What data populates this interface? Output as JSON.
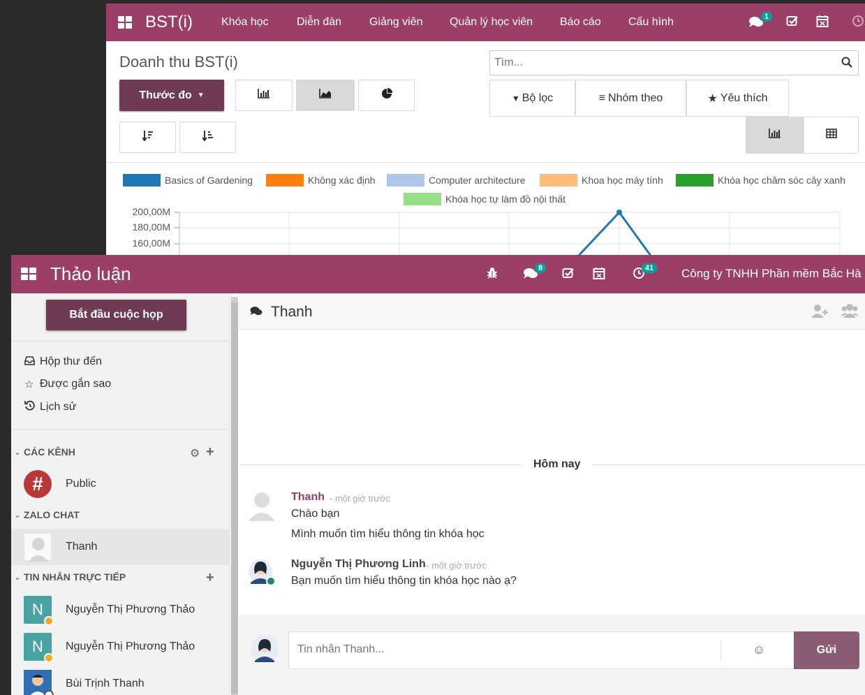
{
  "back_window": {
    "navbar": {
      "brand": "BST(i)",
      "menu": [
        "Khóa học",
        "Diễn đàn",
        "Giảng viên",
        "Quản lý học viên",
        "Báo cáo",
        "Cấu hình"
      ],
      "messages_badge": "1"
    },
    "title": "Doanh thu BST(i)",
    "measures_button": "Thước đo",
    "search_placeholder": "Tìm...",
    "filters": {
      "filter": "Bộ lọc",
      "group_by": "Nhóm theo",
      "favorites": "Yêu thích"
    },
    "icons": {
      "bar_chart": "bar-chart-icon",
      "area_chart": "area-chart-icon",
      "pie_chart": "pie-chart-icon",
      "sort_desc": "sort-desc-icon",
      "sort_asc": "sort-asc-icon",
      "graph_view": "graph-view-icon",
      "pivot_view": "pivot-view-icon"
    }
  },
  "chart_data": {
    "type": "line",
    "series": [
      {
        "name": "Basics of Gardening",
        "color": "#1f77b4"
      },
      {
        "name": "Không xác định",
        "color": "#ff7f0e"
      },
      {
        "name": "Computer architecture",
        "color": "#aec7e8"
      },
      {
        "name": "Khoa học máy tính",
        "color": "#ffbb78"
      },
      {
        "name": "Khóa học chăm sóc cây xanh",
        "color": "#2ca02c"
      },
      {
        "name": "Khóa học tự làm đồ nội thất",
        "color": "#98df8a"
      }
    ],
    "y_ticks": [
      "200,00M",
      "180,00M",
      "160,00M"
    ],
    "peak_value": 200000000
  },
  "front_window": {
    "navbar": {
      "brand": "Thảo luận",
      "messages_badge": "8",
      "activity_badge": "41",
      "company": "Công ty TNHH Phần mềm Bắc Hà"
    },
    "sidebar": {
      "start_meeting": "Bắt đầu cuộc họp",
      "mailboxes": [
        {
          "label": "Hộp thư đến",
          "icon": "inbox-icon"
        },
        {
          "label": "Được gắn sao",
          "icon": "star-icon"
        },
        {
          "label": "Lịch sử",
          "icon": "history-icon"
        }
      ],
      "channels_header": "CÁC KÊNH",
      "channels": [
        {
          "label": "Public"
        }
      ],
      "zalo_header": "ZALO CHAT",
      "zalo": [
        {
          "label": "Thanh"
        }
      ],
      "direct_header": "TIN NHẮN TRỰC TIẾP",
      "direct": [
        {
          "label": "Nguyễn Thị Phương Thảo",
          "initial": "N"
        },
        {
          "label": "Nguyễn Thị Phương Thảo",
          "initial": "N"
        },
        {
          "label": "Bùi Trịnh Thanh"
        }
      ]
    },
    "thread": {
      "title": "Thanh",
      "day_separator": "Hôm nay",
      "messages": [
        {
          "author": "Thanh",
          "time": "- một giờ trước",
          "lines": [
            "Chào bạn",
            "Mình muốn tìm hiểu thông tin khóa học"
          ]
        },
        {
          "author": "Nguyễn Thị Phương Linh",
          "time": "- một giờ trước",
          "lines": [
            "Bạn muốn tìm hiểu thông tin khóa học nào ạ?"
          ]
        }
      ],
      "composer_placeholder": "Tin nhắn Thanh...",
      "send": "Gửi"
    }
  }
}
